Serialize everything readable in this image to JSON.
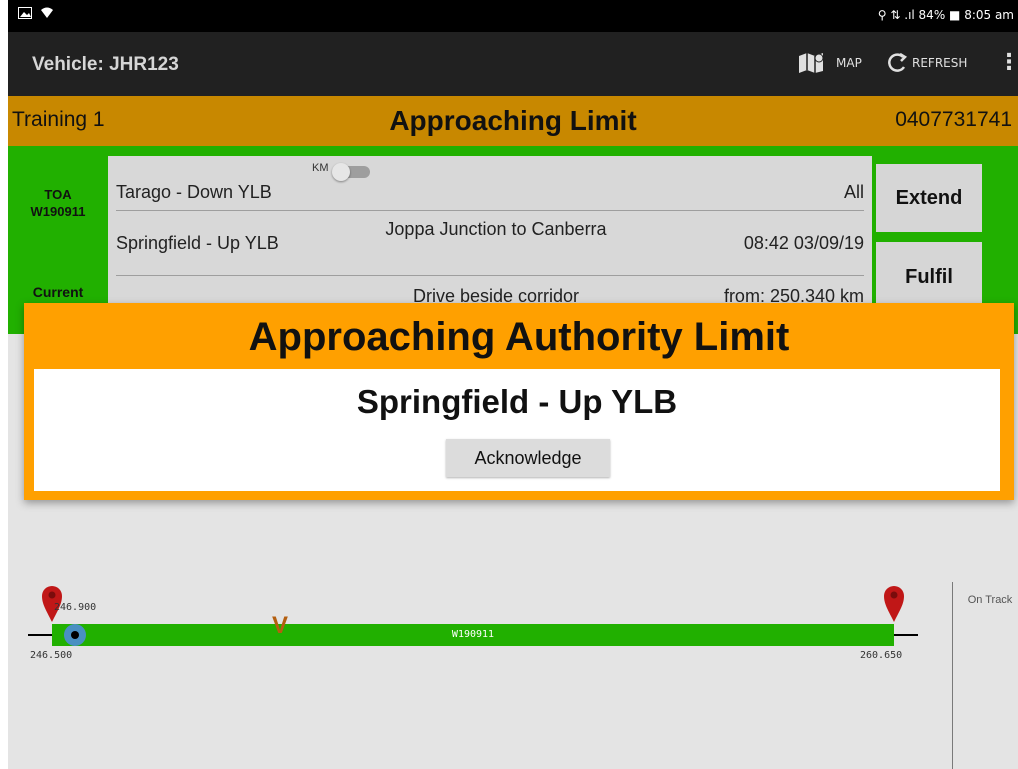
{
  "status_bar": {
    "right_text": "⚲ ⇅ .ıl 84% ■ 8:05 am"
  },
  "app_bar": {
    "title": "Vehicle: JHR123",
    "map_label": "MAP",
    "refresh_label": "REFRESH"
  },
  "banner": {
    "left": "Training 1",
    "center": "Approaching Limit",
    "right": "0407731741"
  },
  "authority": {
    "toa_label": "TOA",
    "toa_id": "W190911",
    "current_label": "Current",
    "km_label": "KM",
    "rows": [
      {
        "a": "Tarago - Down YLB",
        "b": "",
        "c": "All"
      },
      {
        "a": "Springfield - Up YLB",
        "b": "Joppa Junction to Canberra",
        "c": "08:42 03/09/19"
      },
      {
        "a": "",
        "b": "Drive beside corridor",
        "c": "from: 250.340 km"
      }
    ],
    "buttons": {
      "extend": "Extend",
      "fulfil": "Fulfil"
    }
  },
  "dialog": {
    "title": "Approaching Authority Limit",
    "location": "Springfield - Up YLB",
    "acknowledge": "Acknowledge"
  },
  "track": {
    "start_marker": "246.900",
    "start_km": "246.500",
    "end_km": "260.650",
    "label": "W190911",
    "vehicle_marker": "V",
    "on_track": "On Track"
  },
  "colors": {
    "green": "#21b000",
    "orange": "#ffa000",
    "banner": "#c88800",
    "appbar": "#212121"
  }
}
